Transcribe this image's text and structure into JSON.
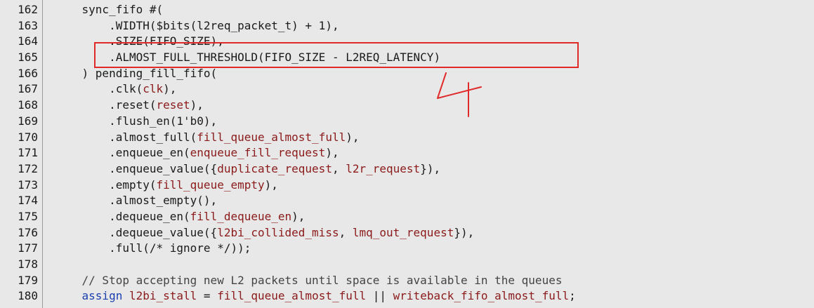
{
  "editor": {
    "lines": [
      {
        "num": "162",
        "tokens": [
          {
            "t": "    sync_fifo #(",
            "c": "plain"
          }
        ]
      },
      {
        "num": "163",
        "tokens": [
          {
            "t": "        .WIDTH($bits(l2req_packet_t) + 1),",
            "c": "plain"
          }
        ]
      },
      {
        "num": "164",
        "tokens": [
          {
            "t": "        .SIZE(FIFO_SIZE),",
            "c": "plain"
          }
        ]
      },
      {
        "num": "165",
        "tokens": [
          {
            "t": "        .ALMOST_FULL_THRESHOLD(FIFO_SIZE - L2REQ_LATENCY)",
            "c": "plain"
          }
        ]
      },
      {
        "num": "166",
        "tokens": [
          {
            "t": "    ) pending_fill_fifo(",
            "c": "plain"
          }
        ]
      },
      {
        "num": "167",
        "tokens": [
          {
            "t": "        .clk(",
            "c": "plain"
          },
          {
            "t": "clk",
            "c": "arg"
          },
          {
            "t": "),",
            "c": "plain"
          }
        ]
      },
      {
        "num": "168",
        "tokens": [
          {
            "t": "        .reset(",
            "c": "plain"
          },
          {
            "t": "reset",
            "c": "arg"
          },
          {
            "t": "),",
            "c": "plain"
          }
        ]
      },
      {
        "num": "169",
        "tokens": [
          {
            "t": "        .flush_en(1'b0),",
            "c": "plain"
          }
        ]
      },
      {
        "num": "170",
        "tokens": [
          {
            "t": "        .almost_full(",
            "c": "plain"
          },
          {
            "t": "fill_queue_almost_full",
            "c": "arg"
          },
          {
            "t": "),",
            "c": "plain"
          }
        ]
      },
      {
        "num": "171",
        "tokens": [
          {
            "t": "        .enqueue_en(",
            "c": "plain"
          },
          {
            "t": "enqueue_fill_request",
            "c": "arg"
          },
          {
            "t": "),",
            "c": "plain"
          }
        ]
      },
      {
        "num": "172",
        "tokens": [
          {
            "t": "        .enqueue_value({",
            "c": "plain"
          },
          {
            "t": "duplicate_request",
            "c": "arg"
          },
          {
            "t": ", ",
            "c": "plain"
          },
          {
            "t": "l2r_request",
            "c": "arg"
          },
          {
            "t": "}),",
            "c": "plain"
          }
        ]
      },
      {
        "num": "173",
        "tokens": [
          {
            "t": "        .empty(",
            "c": "plain"
          },
          {
            "t": "fill_queue_empty",
            "c": "arg"
          },
          {
            "t": "),",
            "c": "plain"
          }
        ]
      },
      {
        "num": "174",
        "tokens": [
          {
            "t": "        .almost_empty(),",
            "c": "plain"
          }
        ]
      },
      {
        "num": "175",
        "tokens": [
          {
            "t": "        .dequeue_en(",
            "c": "plain"
          },
          {
            "t": "fill_dequeue_en",
            "c": "arg"
          },
          {
            "t": "),",
            "c": "plain"
          }
        ]
      },
      {
        "num": "176",
        "tokens": [
          {
            "t": "        .dequeue_value({",
            "c": "plain"
          },
          {
            "t": "l2bi_collided_miss",
            "c": "arg"
          },
          {
            "t": ", ",
            "c": "plain"
          },
          {
            "t": "lmq_out_request",
            "c": "arg"
          },
          {
            "t": "}),",
            "c": "plain"
          }
        ]
      },
      {
        "num": "177",
        "tokens": [
          {
            "t": "        .full(/* ignore */));",
            "c": "plain"
          }
        ]
      },
      {
        "num": "178",
        "tokens": []
      },
      {
        "num": "179",
        "tokens": [
          {
            "t": "    // Stop accepting new L2 packets until space is available in the queues",
            "c": "cmt"
          }
        ]
      },
      {
        "num": "180",
        "tokens": [
          {
            "t": "    ",
            "c": "plain"
          },
          {
            "t": "assign",
            "c": "kw"
          },
          {
            "t": " ",
            "c": "plain"
          },
          {
            "t": "l2bi_stall",
            "c": "arg"
          },
          {
            "t": " = ",
            "c": "plain"
          },
          {
            "t": "fill_queue_almost_full",
            "c": "arg"
          },
          {
            "t": " || ",
            "c": "plain"
          },
          {
            "t": "writeback_fifo_almost_full",
            "c": "arg"
          },
          {
            "t": ";",
            "c": "plain"
          }
        ]
      }
    ]
  },
  "colors": {
    "background": "#e8e8e8",
    "argument": "#8b1a1a",
    "keyword": "#1a3fb0",
    "annotation": "#e02a2a"
  }
}
